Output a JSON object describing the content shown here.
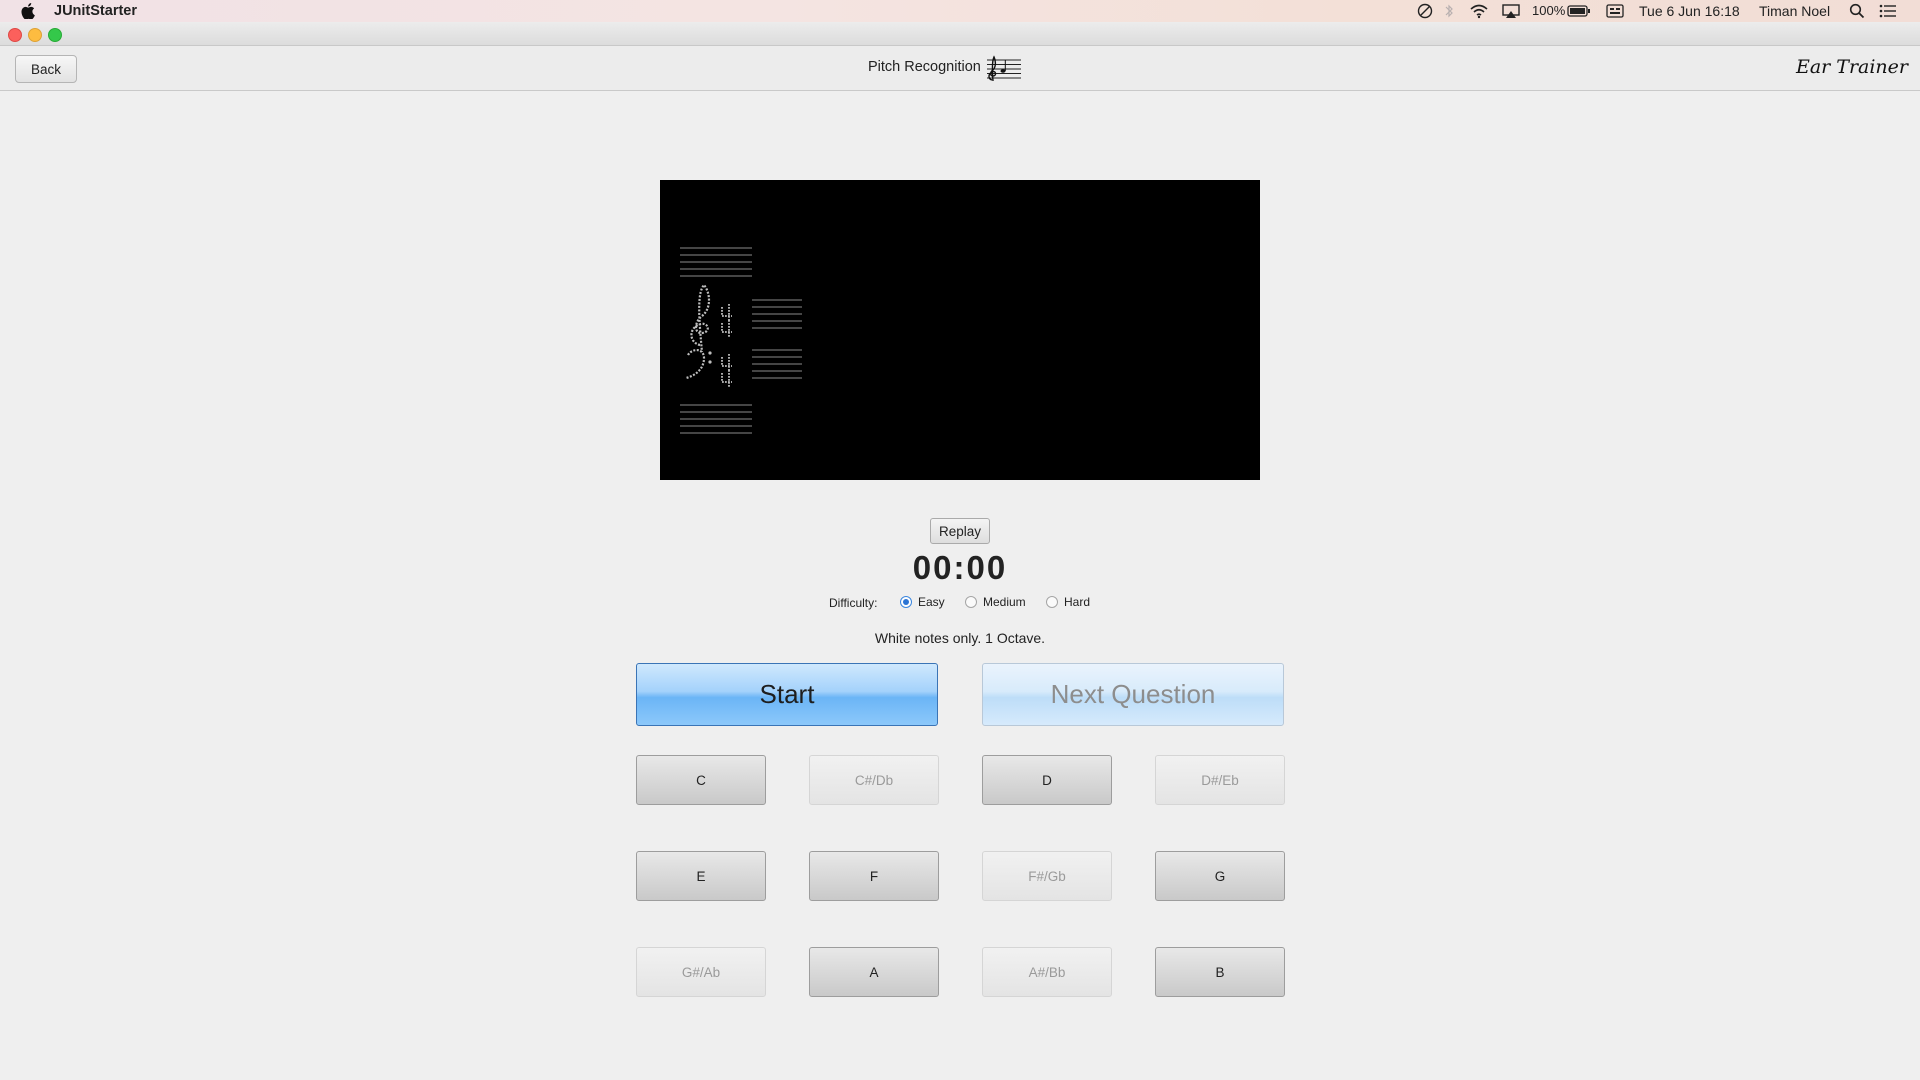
{
  "menubar": {
    "app_name": "JUnitStarter",
    "battery": "100%",
    "datetime": "Tue 6 Jun  16:18",
    "user": "Timan Noel"
  },
  "header": {
    "back_label": "Back",
    "title": "Pitch Recognition",
    "brand": "Ear Trainer"
  },
  "controls": {
    "replay_label": "Replay",
    "timer": "00:00",
    "difficulty_label": "Difficulty:",
    "difficulty_options": [
      "Easy",
      "Medium",
      "Hard"
    ],
    "difficulty_selected": "Easy",
    "description": "White notes only. 1 Octave.",
    "start_label": "Start",
    "next_label": "Next Question"
  },
  "notes": [
    {
      "label": "C",
      "enabled": true
    },
    {
      "label": "C#/Db",
      "enabled": false
    },
    {
      "label": "D",
      "enabled": true
    },
    {
      "label": "D#/Eb",
      "enabled": false
    },
    {
      "label": "E",
      "enabled": true
    },
    {
      "label": "F",
      "enabled": true
    },
    {
      "label": "F#/Gb",
      "enabled": false
    },
    {
      "label": "G",
      "enabled": true
    },
    {
      "label": "G#/Ab",
      "enabled": false
    },
    {
      "label": "A",
      "enabled": true
    },
    {
      "label": "A#/Bb",
      "enabled": false
    },
    {
      "label": "B",
      "enabled": true
    }
  ]
}
